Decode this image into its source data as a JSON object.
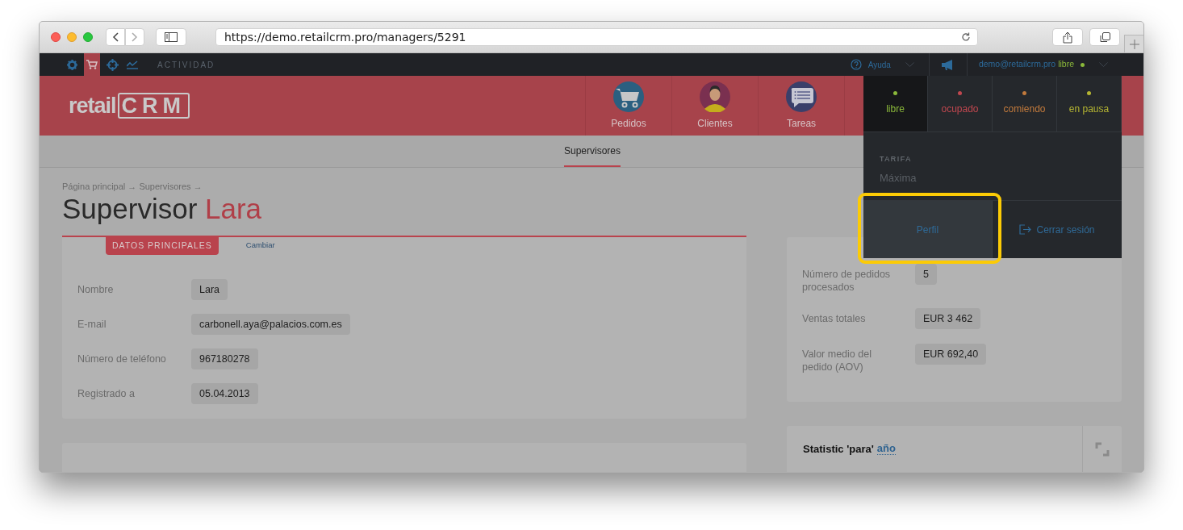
{
  "browser": {
    "url": "https://demo.retailcrm.pro/managers/5291"
  },
  "topbar": {
    "icons": [
      {
        "kind": "settings",
        "selected": false
      },
      {
        "kind": "cart",
        "selected": true
      },
      {
        "kind": "target",
        "selected": false
      },
      {
        "kind": "chart",
        "selected": false
      }
    ],
    "activity": "ACTIVIDAD",
    "help": "Ayuda",
    "account": {
      "email": "demo@retailcrm.pro",
      "status": "libre",
      "color": "#8ab83a"
    }
  },
  "logo": {
    "text": "retail",
    "mark": "CRM"
  },
  "nav": [
    {
      "kind": "orders",
      "label": "Pedidos"
    },
    {
      "kind": "customers",
      "label": "Clientes"
    },
    {
      "kind": "tasks",
      "label": "Tareas"
    }
  ],
  "subnav": [
    {
      "label": "Supervisores",
      "selected": true
    }
  ],
  "breadcrumb": "Página principal → Supervisores →",
  "title": {
    "prefix": "Supervisor",
    "name": "Lara"
  },
  "main_card": {
    "tabs": [
      {
        "label": "DATOS PRINCIPALES",
        "selected": true
      },
      {
        "label": "Cambiar",
        "selected": false
      }
    ],
    "fields": [
      {
        "label": "Nombre",
        "value": "Lara"
      },
      {
        "label": "E-mail",
        "value": "carbonell.aya@palacios.com.es"
      },
      {
        "label": "Número de teléfono",
        "value": "967180278"
      },
      {
        "label": "Registrado a",
        "value": "05.04.2013"
      }
    ]
  },
  "stats_card": {
    "fields": [
      {
        "label": "Número de pedidos procesados",
        "value": "5"
      },
      {
        "label": "Ventas totales",
        "value": "EUR 3 462"
      },
      {
        "label": "Valor medio del pedido (AOV)",
        "value": "EUR 692,40"
      }
    ]
  },
  "statistic_card": {
    "title": "Statistic 'para'",
    "period": "año"
  },
  "account_menu": {
    "statuses": [
      {
        "label": "libre",
        "color": "#8ab83a",
        "selected": true
      },
      {
        "label": "ocupado",
        "color": "#c0474f",
        "selected": false
      },
      {
        "label": "comiendo",
        "color": "#c27a3c",
        "selected": false
      },
      {
        "label": "en pausa",
        "color": "#b5b532",
        "selected": false
      }
    ],
    "tariff_label": "TARIFA",
    "tariff": "Máxima",
    "actions": [
      {
        "kind": "profile",
        "label": "Perfil",
        "highlighted": true
      },
      {
        "kind": "logout",
        "label": "Cerrar sesión",
        "highlighted": false
      }
    ]
  }
}
